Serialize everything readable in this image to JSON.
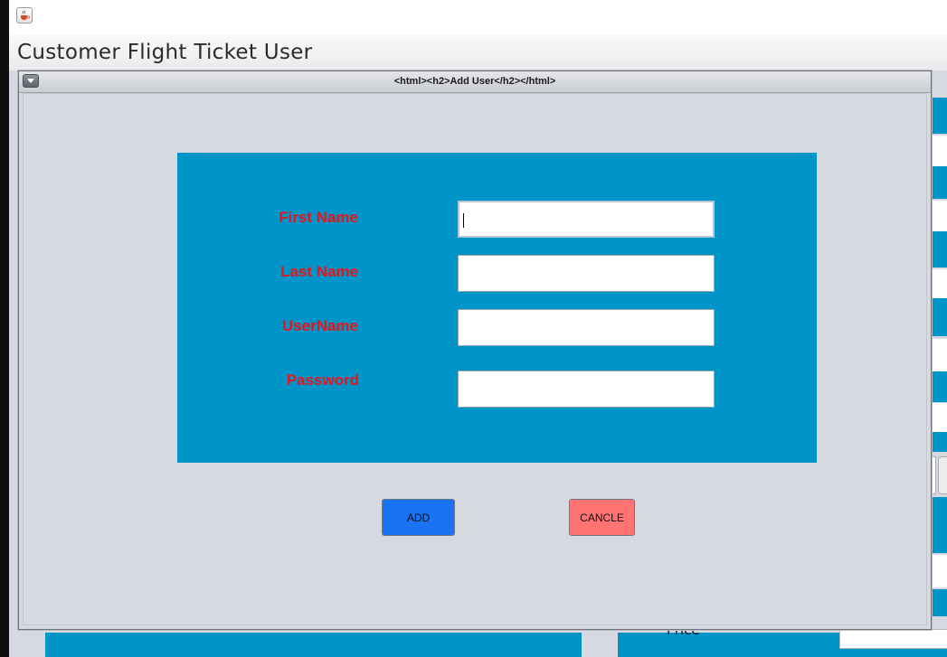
{
  "window": {
    "title": "Customer Flight Ticket User"
  },
  "background": {
    "price_label": "Price"
  },
  "dialog": {
    "title": "<html><h2>Add User</h2></html>"
  },
  "form": {
    "fields": [
      {
        "label": "First Name",
        "value": ""
      },
      {
        "label": "Last Name",
        "value": ""
      },
      {
        "label": "UserName",
        "value": ""
      },
      {
        "label": "Password",
        "value": ""
      }
    ]
  },
  "buttons": {
    "add_label": "ADD",
    "cancel_label": "CANCLE"
  },
  "colors": {
    "panel": "#0095c8",
    "label": "#e8141c",
    "add_button": "#1a73f5",
    "cancel_button": "#ff7373"
  },
  "icons": {
    "app": "java-cup-icon",
    "dialog_menu": "chevron-down-icon"
  }
}
